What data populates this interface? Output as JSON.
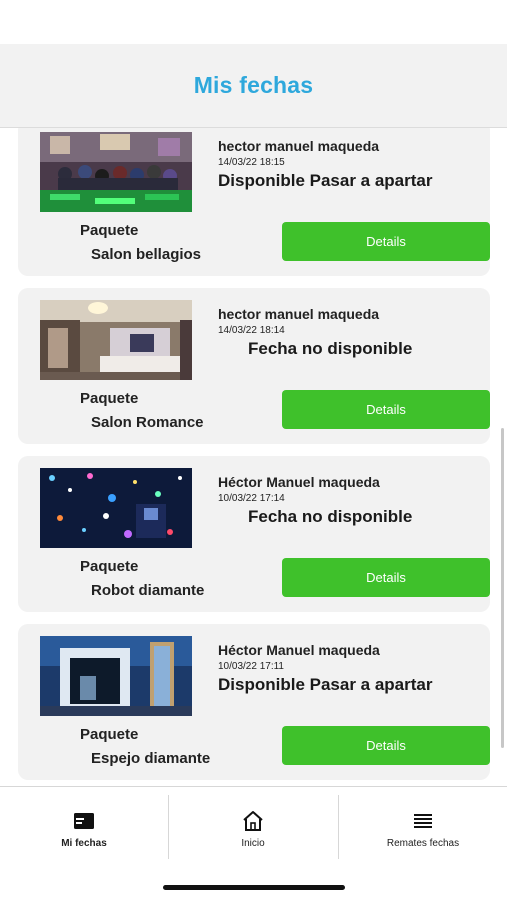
{
  "header": {
    "title": "Mis fechas"
  },
  "bookings": [
    {
      "owner": "hector manuel maqueda",
      "datetime": "14/03/22 18:15",
      "status": "Disponible Pasar a apartar",
      "package_label": "Paquete",
      "package_name": "Salon bellagios",
      "details_label": "Details",
      "image": "party-hall-photo"
    },
    {
      "owner": "hector manuel maqueda",
      "datetime": "14/03/22 18:14",
      "status": "Fecha no disponible",
      "package_label": "Paquete",
      "package_name": "Salon Romance",
      "details_label": "Details",
      "image": "salon-room-photo"
    },
    {
      "owner": "Héctor Manuel maqueda",
      "datetime": "10/03/22 17:14",
      "status": "Fecha no disponible",
      "package_label": "Paquete",
      "package_name": "Robot diamante",
      "details_label": "Details",
      "image": "disco-lights-photo"
    },
    {
      "owner": "Héctor Manuel maqueda",
      "datetime": "10/03/22 17:11",
      "status": "Disponible Pasar a apartar",
      "package_label": "Paquete",
      "package_name": "Espejo diamante",
      "details_label": "Details",
      "image": "photo-booth-photo"
    }
  ],
  "tabbar": {
    "tabs": [
      {
        "label": "Mi fechas",
        "icon": "calendar-card-icon",
        "active": true
      },
      {
        "label": "Inicio",
        "icon": "home-icon",
        "active": false
      },
      {
        "label": "Remates fechas",
        "icon": "list-icon",
        "active": false
      }
    ]
  },
  "colors": {
    "title": "#2ea8dc",
    "button": "#3fc12b",
    "card": "#f2f2f2"
  }
}
